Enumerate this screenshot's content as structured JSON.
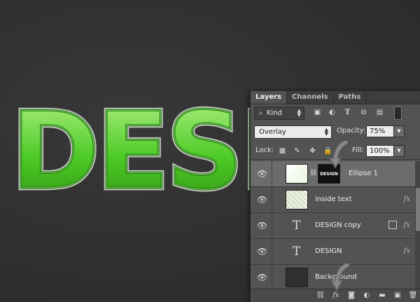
{
  "canvas": {
    "art_text": "DESI"
  },
  "tabs": [
    {
      "label": "Layers",
      "active": true
    },
    {
      "label": "Channels",
      "active": false
    },
    {
      "label": "Paths",
      "active": false
    }
  ],
  "filter": {
    "kind_label": "Kind"
  },
  "blend": {
    "mode": "Overlay",
    "opacity_label": "Opacity:",
    "opacity_value": "75%"
  },
  "lock": {
    "label": "Lock:",
    "fill_label": "Fill:",
    "fill_value": "100%"
  },
  "layers": [
    {
      "name": "Ellipse 1",
      "mask_text": "DESIGN",
      "selected": true
    },
    {
      "name": "inside text"
    },
    {
      "name": "DESIGN copy"
    },
    {
      "name": "DESIGN"
    },
    {
      "name": "Background"
    }
  ],
  "icons": {
    "fx_badge": "fx",
    "type_glyph": "T"
  },
  "colors": {
    "accent_green": "#3cc31e",
    "panel_bg": "#535353",
    "selected_row": "#6c6c6c"
  }
}
